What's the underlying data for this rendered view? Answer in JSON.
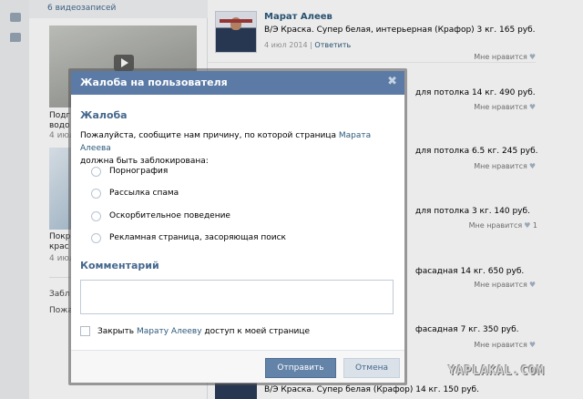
{
  "left_panel": {
    "videos_header": "6 видеозаписей",
    "video1": {
      "title": "Подг",
      "title2": "водо",
      "date": "4 июл"
    },
    "video2": {
      "title": "Покр",
      "title2": "крас",
      "date": "4 июл"
    },
    "link1": "Забл",
    "link2": "Пожа"
  },
  "feed": {
    "post": {
      "author": "Марат Алеев",
      "text": "В/Э Краска. Супер белая, интерьерная (Крафор) 3 кг. 165 руб.",
      "date": "4 июл 2014",
      "separator": "|",
      "reply": "Ответить"
    },
    "like_label": "Мне нравится",
    "heart": "♥",
    "rows": [
      {
        "text": "для потолка 14 кг. 490 руб.",
        "count": ""
      },
      {
        "text": "для потолка 6.5 кг. 245 руб.",
        "count": ""
      },
      {
        "text": "для потолка 3 кг. 140 руб.",
        "count": "1"
      },
      {
        "text": "фасадная 14 кг. 650 руб.",
        "count": ""
      },
      {
        "text": "фасадная 7 кг. 350 руб.",
        "count": ""
      }
    ],
    "bottom_text": "В/Э Краска. Супер белая (Крафор) 14 кг. 150 руб."
  },
  "watermark": "YAPLAKAL.COM",
  "modal": {
    "title": "Жалоба на пользователя",
    "close": "✖",
    "complaint_heading": "Жалоба",
    "reason_prefix": "Пожалуйста, сообщите нам причину, по которой страница",
    "reason_link": "Марата Алеева",
    "reason_suffix": "должна быть заблокирована:",
    "options": [
      "Порнография",
      "Рассылка спама",
      "Оскорбительное поведение",
      "Рекламная страница, засоряющая поиск"
    ],
    "comment_heading": "Комментарий",
    "comment_value": "",
    "close_access_prefix": "Закрыть",
    "close_access_link": "Марату Алееву",
    "close_access_suffix": "доступ к моей странице",
    "send_label": "Отправить",
    "cancel_label": "Отмена"
  },
  "colors": {
    "header": "#5b7ba6",
    "link": "#2b587a",
    "send_button": "#6383a8"
  }
}
